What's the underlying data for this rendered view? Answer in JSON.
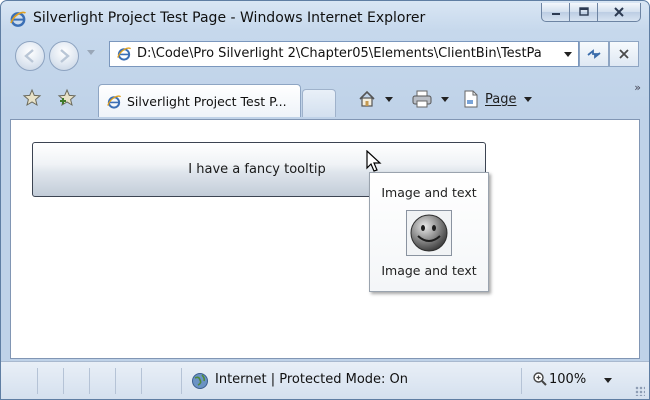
{
  "window": {
    "title": "Silverlight Project Test Page - Windows Internet Explorer",
    "caption_buttons": {
      "minimize_icon": "minimize-icon",
      "maximize_icon": "maximize-icon",
      "close_icon": "close-icon"
    }
  },
  "navigation": {
    "address": "D:\\Code\\Pro Silverlight 2\\Chapter05\\Elements\\ClientBin\\TestPa",
    "back_icon": "back-arrow-icon",
    "forward_icon": "forward-arrow-icon",
    "refresh_icon": "refresh-icon",
    "stop_icon": "stop-icon"
  },
  "command_bar": {
    "tab_label": "Silverlight Project Test P...",
    "page_menu_label": "Page",
    "favorites_icon": "favorites-star-icon",
    "add_favorites_icon": "add-favorites-icon",
    "home_icon": "home-icon",
    "print_icon": "print-icon",
    "page_icon": "page-icon",
    "overflow_label": "»"
  },
  "content": {
    "fancy_button_label": "I have a fancy tooltip",
    "tooltip": {
      "top_text": "Image and text",
      "bottom_text": "Image and text",
      "image_icon": "smiley-face-icon"
    }
  },
  "status_bar": {
    "zone_text": "Internet | Protected Mode: On",
    "zoom": "100%"
  },
  "colors": {
    "chrome": "#c6d8ec",
    "border": "#5f7ea3",
    "button_border": "#3c4452"
  }
}
